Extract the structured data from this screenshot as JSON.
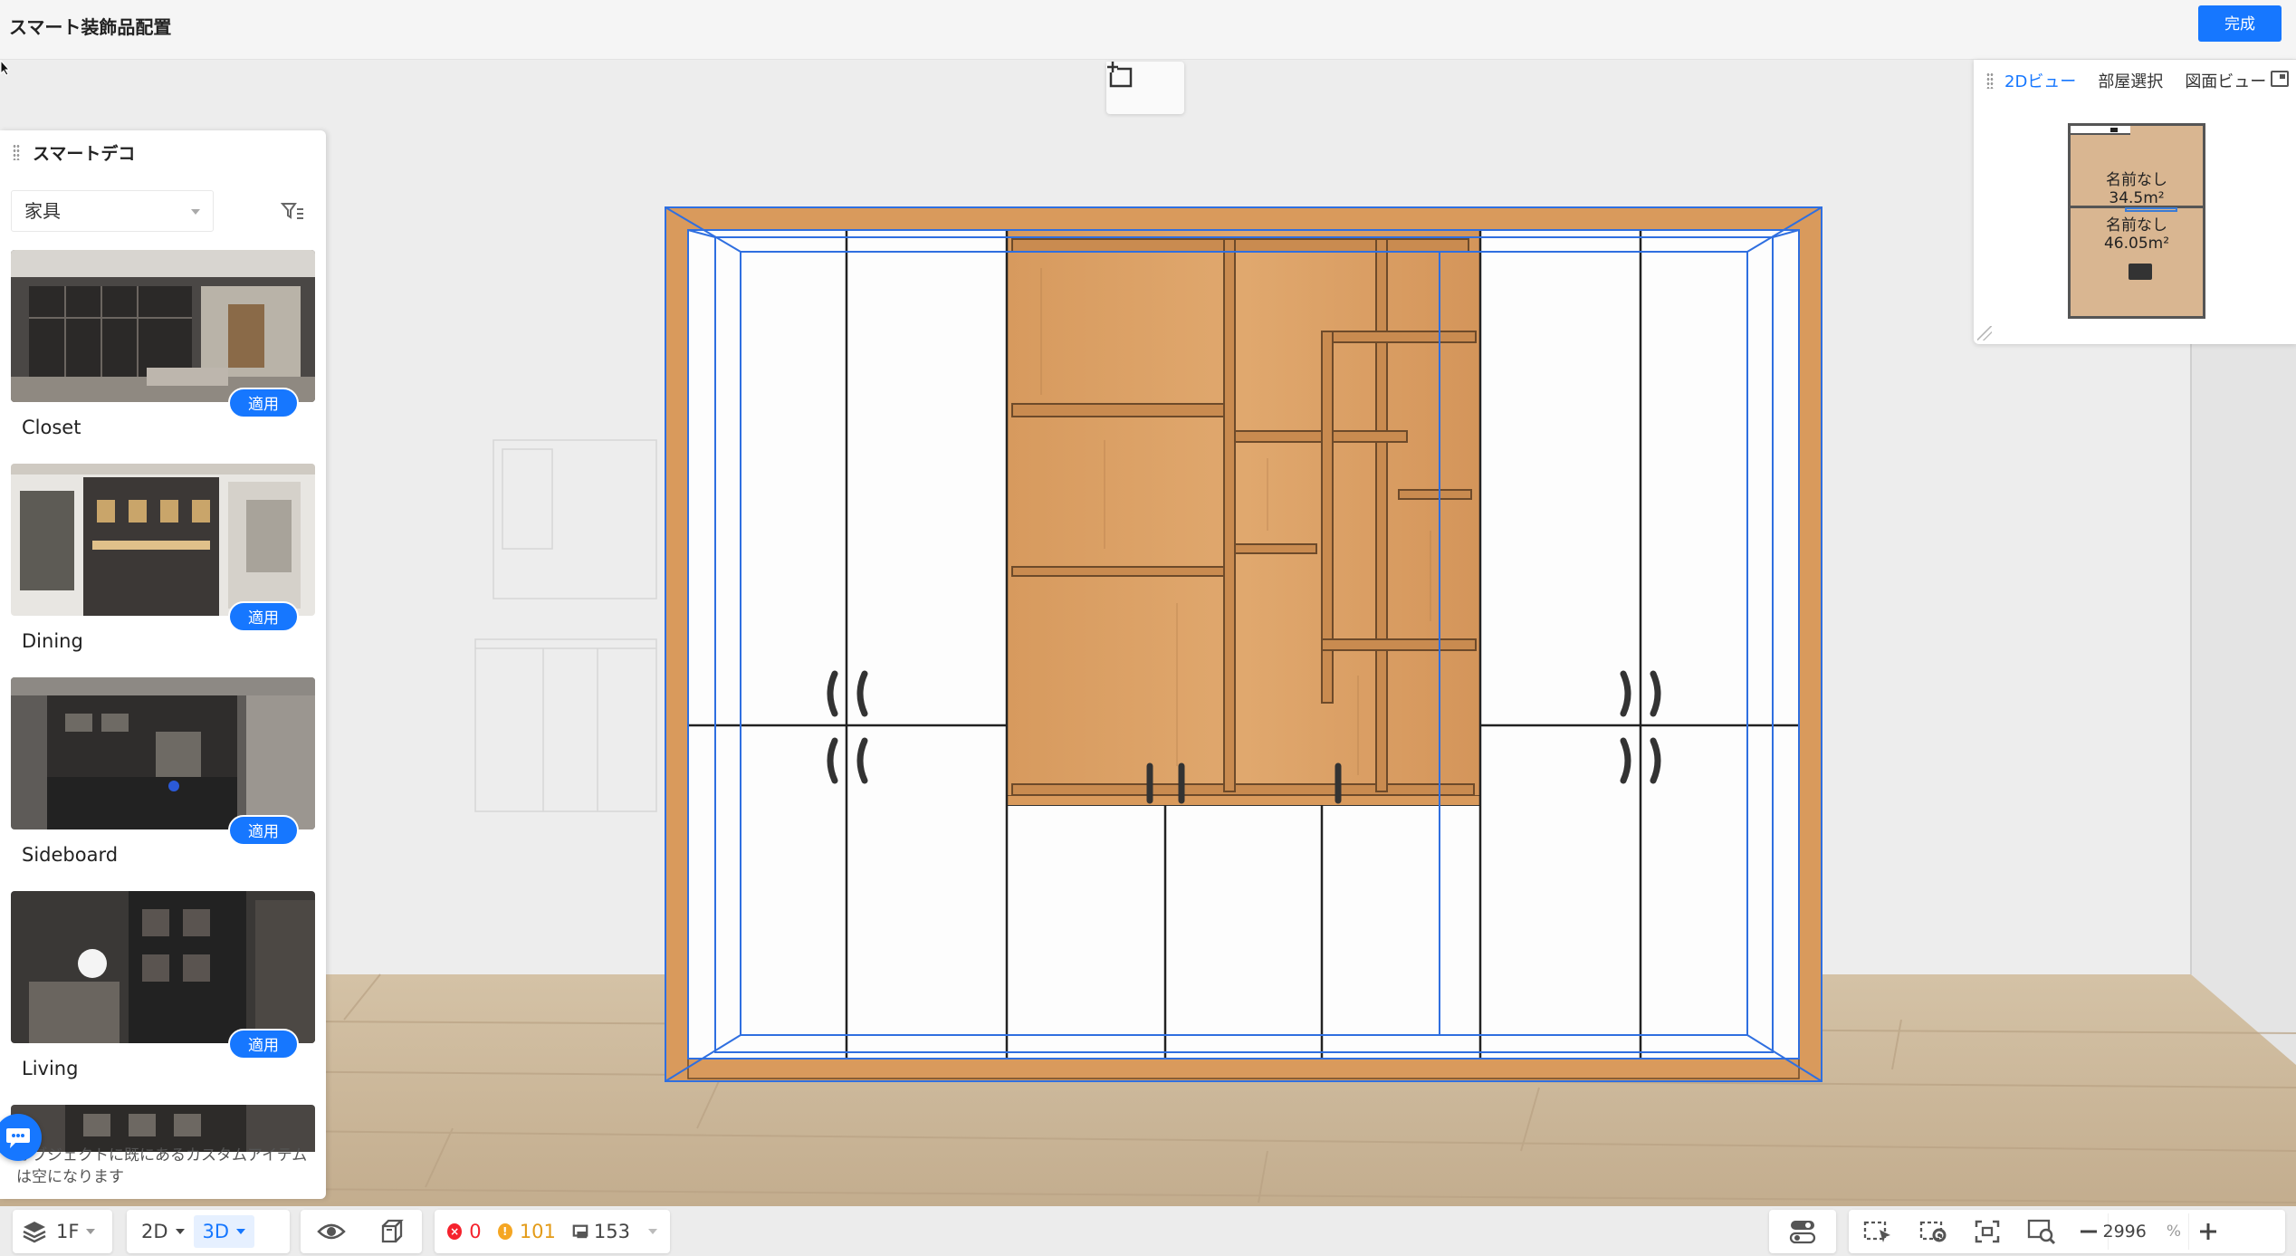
{
  "header": {
    "title": "スマート装飾品配置",
    "done_label": "完成"
  },
  "panel": {
    "title": "スマートデコ",
    "category": "家具",
    "cards": [
      {
        "label": "Closet",
        "apply": "適用"
      },
      {
        "label": "Dining",
        "apply": "適用"
      },
      {
        "label": "Sideboard",
        "apply": "適用"
      },
      {
        "label": "Living",
        "apply": "適用"
      }
    ],
    "hint": "オブジェクトに既にあるカスタムアイテムは空になります"
  },
  "minimap": {
    "tabs": [
      "2Dビュー",
      "部屋選択",
      "図面ビュー"
    ],
    "active_tab": "2Dビュー",
    "rooms": [
      {
        "name": "名前なし",
        "area": "34.5m²"
      },
      {
        "name": "名前なし",
        "area": "46.05m²"
      }
    ]
  },
  "toolbar": {
    "floor": "1F",
    "mode_2d": "2D",
    "mode_3d": "3D",
    "errors": "0",
    "warnings": "101",
    "items": "153",
    "zoom": "2996",
    "zoom_unit": "%"
  },
  "colors": {
    "accent": "#1677ff",
    "wood": "#d9995a",
    "warning": "#f5a623",
    "error": "#f5222d"
  },
  "icons": [
    "layers-icon",
    "eye-icon",
    "cube-icon",
    "error-icon",
    "warning-icon",
    "object-count-icon",
    "settings-toggle-icon",
    "select-region-icon",
    "select-settings-icon",
    "focus-icon",
    "zoom-search-icon",
    "minus-icon",
    "plus-icon",
    "filter-icon",
    "chat-icon",
    "add-frame-icon"
  ]
}
